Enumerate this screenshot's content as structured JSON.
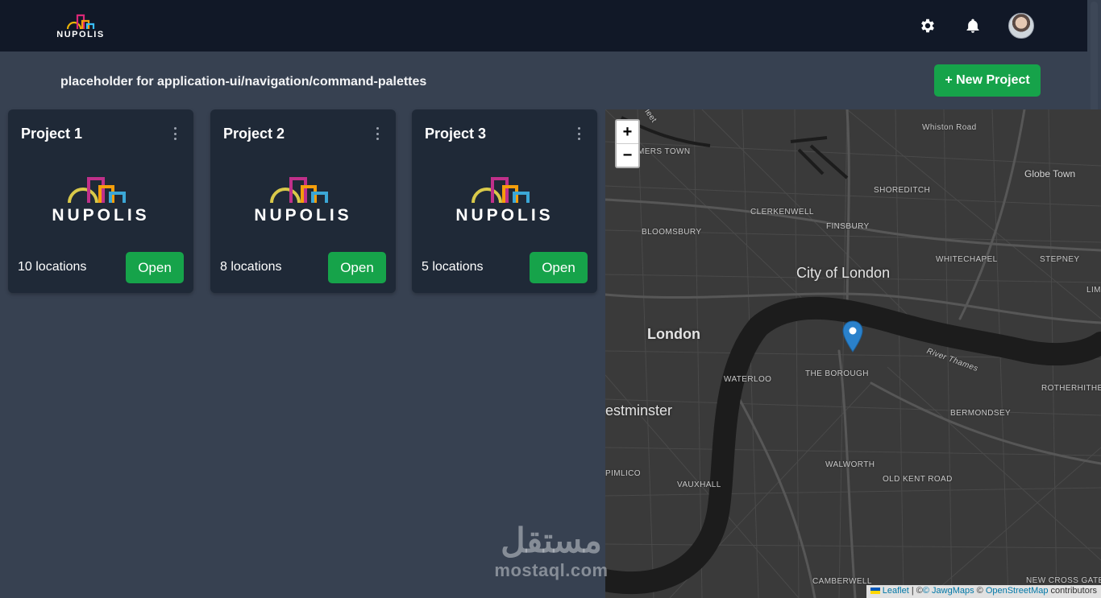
{
  "header": {
    "logo_text": "NUPOLIS",
    "settings_icon": "gear-icon",
    "notifications_icon": "bell-icon"
  },
  "page": {
    "placeholder_text": "placeholder for application-ui/navigation/command-palettes",
    "new_project_label": "+ New Project"
  },
  "projects": [
    {
      "title": "Project 1",
      "logo_text": "NUPOLIS",
      "locations": "10 locations",
      "open_label": "Open"
    },
    {
      "title": "Project 2",
      "logo_text": "NUPOLIS",
      "locations": "8 locations",
      "open_label": "Open"
    },
    {
      "title": "Project 3",
      "logo_text": "NUPOLIS",
      "locations": "5 locations",
      "open_label": "Open"
    }
  ],
  "map": {
    "zoom_in": "+",
    "zoom_out": "−",
    "labels": {
      "fleet": "Fleet",
      "somers_town": "MERS TOWN",
      "whiston_road": "Whiston Road",
      "globe_town": "Globe Town",
      "shoreditch": "SHOREDITCH",
      "clerkenwell": "CLERKENWELL",
      "finsbury": "FINSBURY",
      "bloomsbury": "BLOOMSBURY",
      "city_of_london": "City of London",
      "whitechapel": "WHITECHAPEL",
      "stepney": "STEPNEY",
      "lim": "LIM",
      "london": "London",
      "river_thames": "River Thames",
      "waterloo": "WATERLOO",
      "the_borough": "THE BOROUGH",
      "rotherhithe": "ROTHERHITHE",
      "westminster": "estminster",
      "bermondsey": "BERMONDSEY",
      "pimlico": "PIMLICO",
      "walworth": "WALWORTH",
      "vauxhall": "VAUXHALL",
      "old_kent_road": "OLD KENT ROAD",
      "camberwell": "CAMBERWELL",
      "new_cross_gate": "NEW CROSS GATE"
    },
    "attribution": {
      "leaflet": "Leaflet",
      "sep1": " | ©",
      "jawg": "© Jawg",
      "jawg_maps": "Maps",
      "sep2": " © ",
      "osm": "OpenStreetMap",
      "contributors": " contributors"
    },
    "colors": {
      "marker": "#2a81cb",
      "river": "#1c1c1c",
      "land": "#3a3a3a",
      "roads": "#555555"
    }
  },
  "watermark": {
    "arabic": "مستقل",
    "latin": "mostaql.com"
  },
  "colors": {
    "accent": "#16a34a",
    "topbar": "#111827",
    "card": "#1f2937",
    "page": "#374151"
  }
}
